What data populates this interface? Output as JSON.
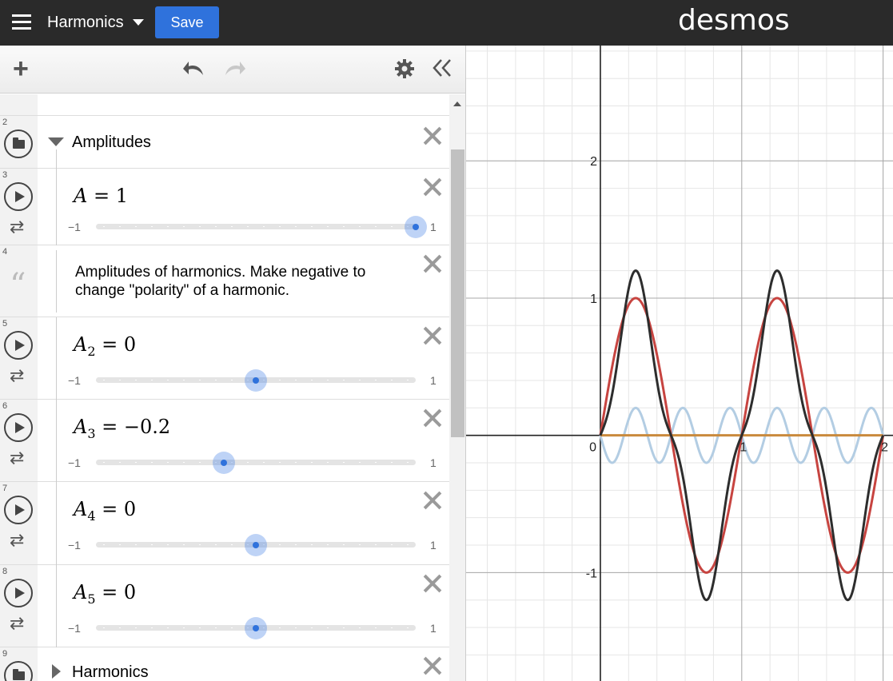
{
  "app": {
    "title": "Harmonics",
    "save_label": "Save",
    "logo": "desmos"
  },
  "expressions": [
    {
      "num": "2",
      "type": "folder",
      "label": "Amplitudes",
      "open": true
    },
    {
      "num": "3",
      "type": "slider",
      "latex_var": "A",
      "sub": "",
      "value_text": "1",
      "min": "−1",
      "max": "1",
      "value": 1
    },
    {
      "num": "4",
      "type": "note",
      "text": "Amplitudes of harmonics. Make negative to change \"polarity\" of a harmonic."
    },
    {
      "num": "5",
      "type": "slider",
      "latex_var": "A",
      "sub": "2",
      "value_text": "0",
      "min": "−1",
      "max": "1",
      "value": 0
    },
    {
      "num": "6",
      "type": "slider",
      "latex_var": "A",
      "sub": "3",
      "value_text": "−0.2",
      "min": "−1",
      "max": "1",
      "value": -0.2
    },
    {
      "num": "7",
      "type": "slider",
      "latex_var": "A",
      "sub": "4",
      "value_text": "0",
      "min": "−1",
      "max": "1",
      "value": 0
    },
    {
      "num": "8",
      "type": "slider",
      "latex_var": "A",
      "sub": "5",
      "value_text": "0",
      "min": "−1",
      "max": "1",
      "value": 0
    },
    {
      "num": "9",
      "type": "folder",
      "label": "Harmonics",
      "open": false
    }
  ],
  "icons": {
    "menu": "hamburger-icon",
    "add": "plus-icon",
    "undo": "undo-icon",
    "redo": "redo-icon",
    "settings": "gear-icon",
    "collapse": "double-chevron-left-icon",
    "play": "play-icon",
    "loop": "loop-icon",
    "folder": "folder-icon",
    "note": "quote-icon",
    "delete": "close-icon"
  },
  "chart_data": {
    "type": "line",
    "x_ticks": [
      "0",
      "1",
      "2"
    ],
    "y_ticks": [
      "2",
      "1",
      "0",
      "-1"
    ],
    "xlim": [
      -0.95,
      2.07
    ],
    "ylim": [
      -1.79,
      2.84
    ],
    "grid": true,
    "series": [
      {
        "expr": "sin(2πx)",
        "color": "#c74440",
        "amplitude": 1,
        "harmonic": 1
      },
      {
        "expr": "-0.2·sin(6πx)",
        "color": "#b3cde3",
        "amplitude": -0.2,
        "harmonic": 3
      },
      {
        "expr": "sin(2πx) - 0.2·sin(6πx)",
        "color": "#2d2d2d"
      },
      {
        "expr": "0",
        "color": "#c98a3d"
      }
    ]
  },
  "colors": {
    "topbar": "#2a2a2a",
    "save": "#2f72dc",
    "slider_handle": "#2f72dc",
    "red_curve": "#c74440",
    "blue_curve": "#b3cde3",
    "black_curve": "#2d2d2d",
    "orange_curve": "#c98a3d"
  }
}
